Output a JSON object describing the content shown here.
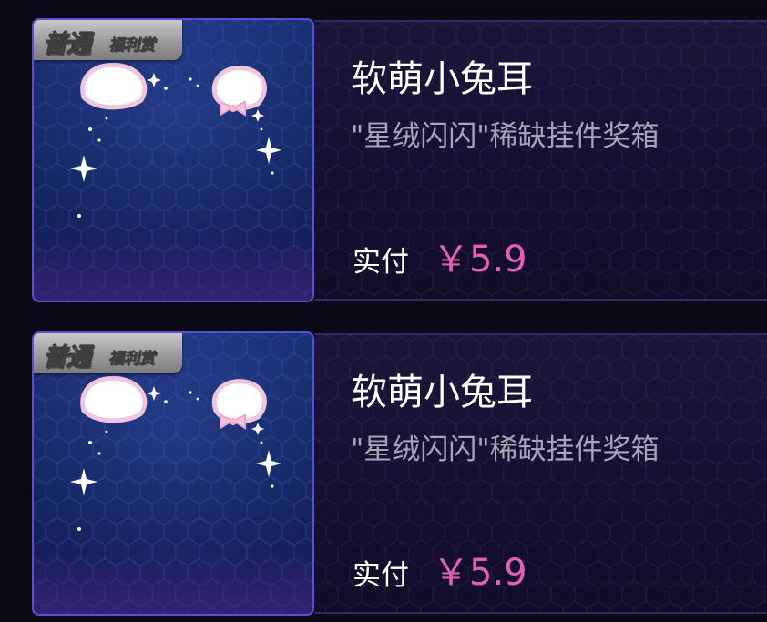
{
  "colors": {
    "price": "#e45fb7",
    "thumb_border": "#5a4fd0",
    "badge": "#a8a8a8",
    "title": "#ffffff",
    "subtitle": "#a9a4b8"
  },
  "items": [
    {
      "badge_main": "普通",
      "badge_sub": "福利赏",
      "title": "软萌小兔耳",
      "subtitle": "\"星绒闪闪\"稀缺挂件奖箱",
      "pay_label": "实付",
      "price": "￥5.9",
      "image_icon": "bunny-ears-icon"
    },
    {
      "badge_main": "普通",
      "badge_sub": "福利赏",
      "title": "软萌小兔耳",
      "subtitle": "\"星绒闪闪\"稀缺挂件奖箱",
      "pay_label": "实付",
      "price": "￥5.9",
      "image_icon": "bunny-ears-icon"
    }
  ]
}
